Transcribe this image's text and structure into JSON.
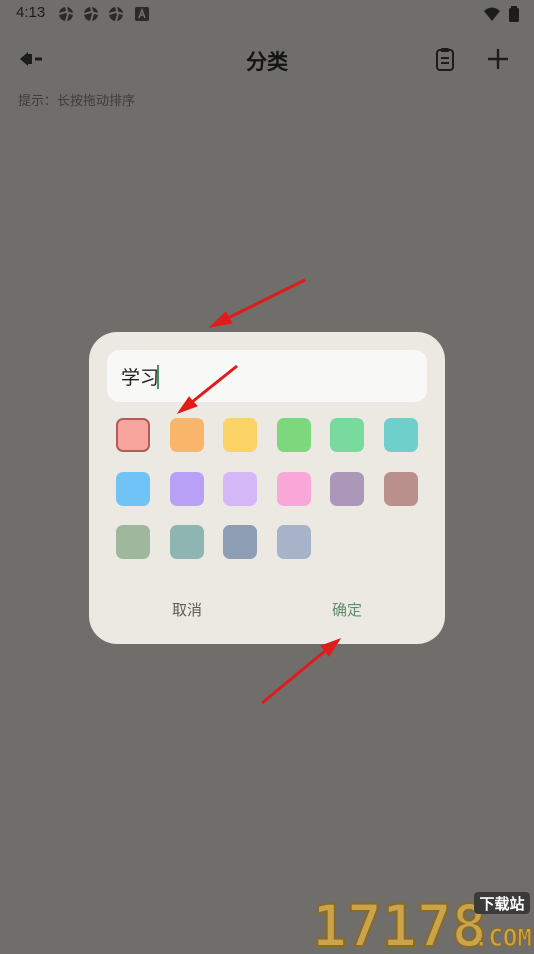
{
  "status_bar": {
    "time": "4:13",
    "left_icons": [
      "aperture-icon",
      "aperture-icon",
      "aperture-icon",
      "font-a-icon"
    ],
    "right_icons": [
      "wifi-icon",
      "battery-icon"
    ]
  },
  "header": {
    "title": "分类",
    "back_icon": "back-arrow-icon",
    "clipboard_icon": "clipboard-icon",
    "add_icon": "plus-icon"
  },
  "hint": "提示：长按拖动排序",
  "dialog": {
    "input_value": "学习",
    "colors": [
      {
        "hex": "#f7a59c",
        "selected": true
      },
      {
        "hex": "#f9b66b",
        "selected": false
      },
      {
        "hex": "#fbd264",
        "selected": false
      },
      {
        "hex": "#7dd87d",
        "selected": false
      },
      {
        "hex": "#78da9c",
        "selected": false
      },
      {
        "hex": "#6ecfcb",
        "selected": false
      },
      {
        "hex": "#6fc3f7",
        "selected": false
      },
      {
        "hex": "#b7a0f5",
        "selected": false
      },
      {
        "hex": "#d4b7f6",
        "selected": false
      },
      {
        "hex": "#f9a7d8",
        "selected": false
      },
      {
        "hex": "#ab97b8",
        "selected": false
      },
      {
        "hex": "#ba908c",
        "selected": false
      },
      {
        "hex": "#9fb89d",
        "selected": false
      },
      {
        "hex": "#8fb5b3",
        "selected": false
      },
      {
        "hex": "#8c9db4",
        "selected": false
      },
      {
        "hex": "#a6b3c8",
        "selected": false
      }
    ],
    "cancel_label": "取消",
    "confirm_label": "确定"
  },
  "watermark": {
    "number": "17178",
    "badge": "下载站",
    "domain": ".COM"
  },
  "theme": {
    "overlay_bg": "#6f6e6a",
    "dialog_bg": "#ece9e3",
    "input_bg": "#f8f8f6",
    "accent": "#5f8c6c",
    "annotation_red": "#e11a1a"
  }
}
